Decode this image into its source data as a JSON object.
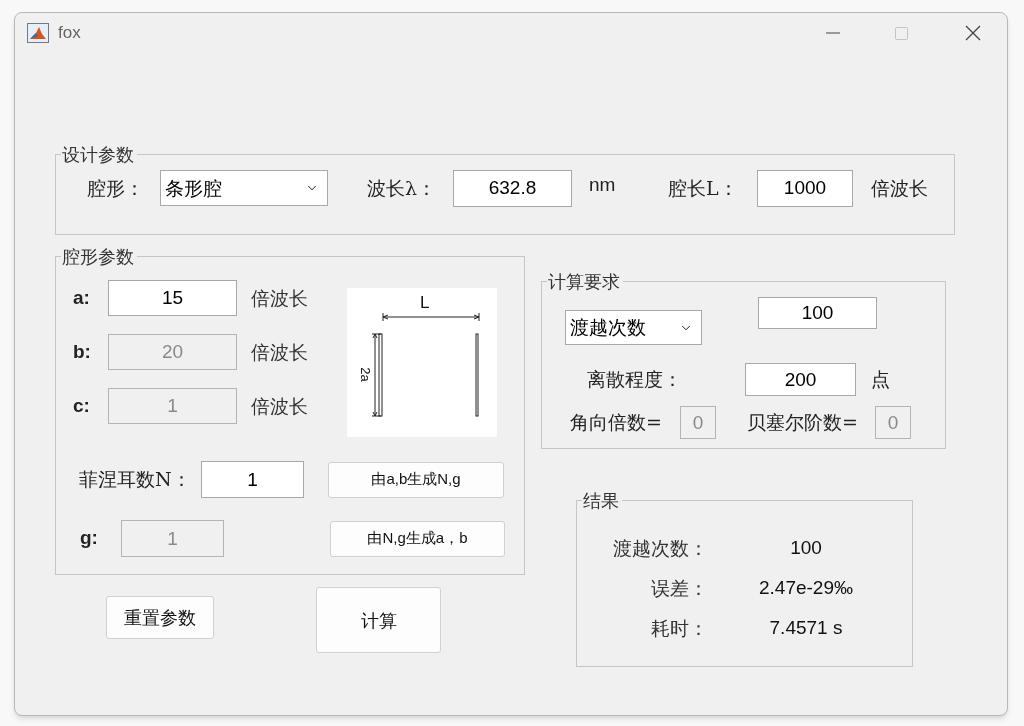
{
  "window": {
    "title": "fox"
  },
  "design_params": {
    "title": "设计参数",
    "cavity_shape": {
      "label": "腔形：",
      "value": "条形腔"
    },
    "wavelength": {
      "label": "波长λ：",
      "value": "632.8",
      "unit": "nm"
    },
    "cavity_length": {
      "label": "腔长L：",
      "value": "1000",
      "unit": "倍波长"
    }
  },
  "shape_params": {
    "title": "腔形参数",
    "fields": [
      {
        "label": "a:",
        "value": "15",
        "unit": "倍波长",
        "disabled": false
      },
      {
        "label": "b:",
        "value": "20",
        "unit": "倍波长",
        "disabled": true
      },
      {
        "label": "c:",
        "value": "1",
        "unit": "倍波长",
        "disabled": true
      }
    ],
    "diagram": {
      "length_label": "L",
      "width_label": "2a"
    },
    "fresnel": {
      "label": "菲涅耳数N：",
      "value": "1",
      "disabled": false,
      "button": "由a,b生成N,g"
    },
    "g": {
      "label": "g:",
      "value": "1",
      "disabled": true,
      "button": "由N,g生成a，b"
    }
  },
  "calc": {
    "title": "计算要求",
    "mode": {
      "value": "渡越次数"
    },
    "count": {
      "value": "100",
      "disabled": false
    },
    "discretization": {
      "label": "离散程度：",
      "value": "200",
      "unit": "点",
      "disabled": false
    },
    "angular": {
      "label": "角向倍数=",
      "value": "0",
      "disabled": true
    },
    "bessel": {
      "label": "贝塞尔阶数=",
      "value": "0",
      "disabled": true
    }
  },
  "results": {
    "title": "结果",
    "rows": [
      {
        "label": "渡越次数：",
        "value": "100"
      },
      {
        "label": "误差：",
        "value": "2.47e-29‰"
      },
      {
        "label": "耗时：",
        "value": "7.4571 s"
      }
    ]
  },
  "buttons": {
    "reset": "重置参数",
    "compute": "计算"
  }
}
